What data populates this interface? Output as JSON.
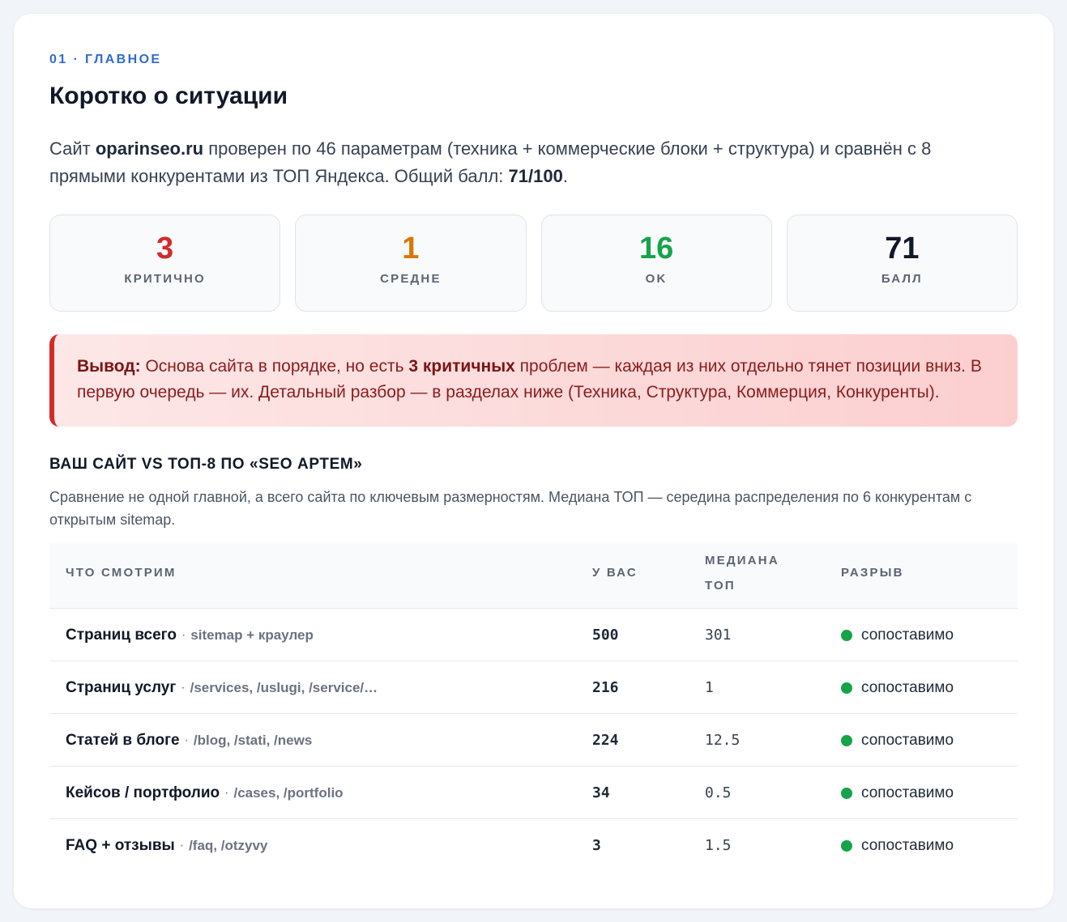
{
  "section": {
    "label": "01 · ГЛАВНОЕ",
    "title": "Коротко о ситуации"
  },
  "intro": {
    "p1": "Сайт ",
    "site": "oparinseo.ru",
    "p2": " проверен по 46 параметрам (техника + коммерческие блоки + структура) и сравнён с 8 прямыми конкурентами из ТОП Яндекса. Общий балл: ",
    "score": "71/100",
    "p3": "."
  },
  "stats": [
    {
      "value": "3",
      "label": "КРИТИЧНО",
      "color": "#d12b2b"
    },
    {
      "value": "1",
      "label": "СРЕДНЕ",
      "color": "#d97706"
    },
    {
      "value": "16",
      "label": "OK",
      "color": "#16a34a"
    },
    {
      "value": "71",
      "label": "БАЛЛ",
      "color": "#111827"
    }
  ],
  "conclusion": {
    "lead": "Вывод:",
    "p1": " Основа сайта в порядке, но есть ",
    "strong": "3 критичных",
    "p2": " проблем — каждая из них отдельно тянет позиции вниз. В первую очередь — их. Детальный разбор — в разделах ниже (Техника, Структура, Коммерция, Конкуренты)."
  },
  "comparison": {
    "title": "ВАШ САЙТ VS ТОП-8 ПО «SEO АРТЕМ»",
    "description": "Сравнение не одной главной, а всего сайта по ключевым размерностям. Медиана ТОП — середина распределения по 6 конкурентам с открытым sitemap.",
    "headers": {
      "what": "ЧТО СМОТРИМ",
      "yours": "У ВАС",
      "median_1": "МЕДИАНА",
      "median_2": "ТОП",
      "gap": "РАЗРЫВ"
    },
    "separator": "·",
    "status_color": "#16a34a",
    "rows": [
      {
        "title": "Страниц всего",
        "path": "sitemap + краулер",
        "yours": "500",
        "median": "301",
        "gap": "сопоставимо"
      },
      {
        "title": "Страниц услуг",
        "path": "/services, /uslugi, /service/…",
        "yours": "216",
        "median": "1",
        "gap": "сопоставимо"
      },
      {
        "title": "Статей в блоге",
        "path": "/blog, /stati, /news",
        "yours": "224",
        "median": "12.5",
        "gap": "сопоставимо"
      },
      {
        "title": "Кейсов / портфолио",
        "path": "/cases, /portfolio",
        "yours": "34",
        "median": "0.5",
        "gap": "сопоставимо"
      },
      {
        "title": "FAQ + отзывы",
        "path": "/faq, /otzyvy",
        "yours": "3",
        "median": "1.5",
        "gap": "сопоставимо"
      }
    ]
  }
}
